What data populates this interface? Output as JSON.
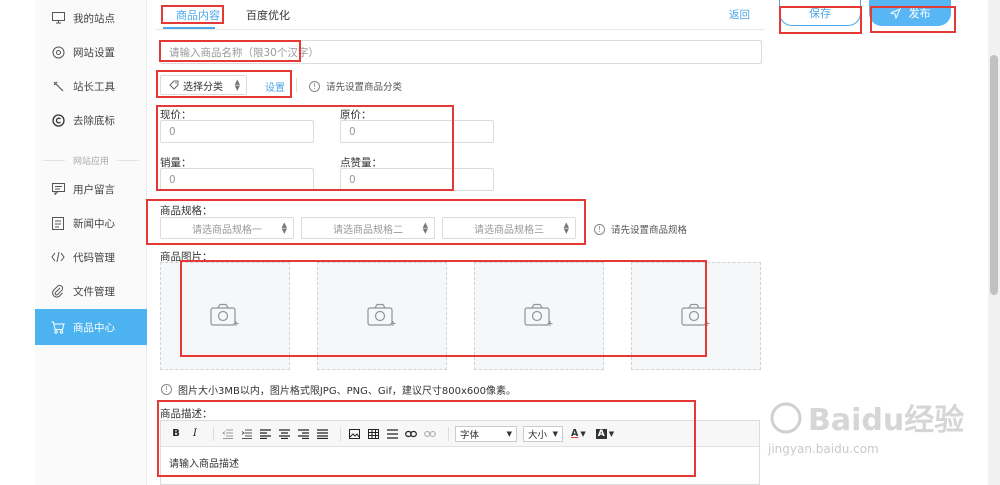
{
  "sidebar": {
    "items": [
      {
        "label": "我的站点",
        "icon": "monitor-icon"
      },
      {
        "label": "网站设置",
        "icon": "gear-icon"
      },
      {
        "label": "站长工具",
        "icon": "tools-icon"
      },
      {
        "label": "去除底标",
        "icon": "copyright-icon"
      },
      {
        "label": "用户留言",
        "icon": "message-icon"
      },
      {
        "label": "新闻中心",
        "icon": "news-icon"
      },
      {
        "label": "代码管理",
        "icon": "code-icon"
      },
      {
        "label": "文件管理",
        "icon": "paperclip-icon"
      },
      {
        "label": "商品中心",
        "icon": "cart-icon"
      }
    ],
    "divider_label": "网站应用",
    "active_index": 8
  },
  "tabs": [
    {
      "label": "商品内容",
      "active": true
    },
    {
      "label": "百度优化",
      "active": false
    }
  ],
  "header": {
    "back_label": "返回",
    "save_label": "保存",
    "publish_label": "发布"
  },
  "form": {
    "name_placeholder": "请输入商品名称（限30个汉字）",
    "category_select": "选择分类",
    "category_settings_link": "设置",
    "category_hint": "请先设置商品分类",
    "current_price_label": "现价：",
    "current_price_value": "0",
    "original_price_label": "原价：",
    "original_price_value": "0",
    "sales_label": "销量：",
    "sales_value": "0",
    "likes_label": "点赞量：",
    "likes_value": "0",
    "spec_label": "商品规格：",
    "spec_selects": [
      "请选商品规格一",
      "请选商品规格二",
      "请选商品规格三"
    ],
    "spec_hint": "请先设置商品规格",
    "image_label": "商品图片：",
    "image_slots": 4,
    "image_hint": "图片大小3MB以内，图片格式限JPG、PNG、Gif，建议尺寸800x600像素。",
    "desc_label": "商品描述：",
    "editor_font_label": "字体",
    "editor_size_label": "大小",
    "editor_body": "请输入商品描述"
  },
  "watermark": {
    "brand": "Baidu经验",
    "url": "jingyan.baidu.com"
  },
  "colors": {
    "accent": "#4da6e8",
    "active_sidebar": "#4db3f0",
    "annotation_red": "#e53935"
  }
}
